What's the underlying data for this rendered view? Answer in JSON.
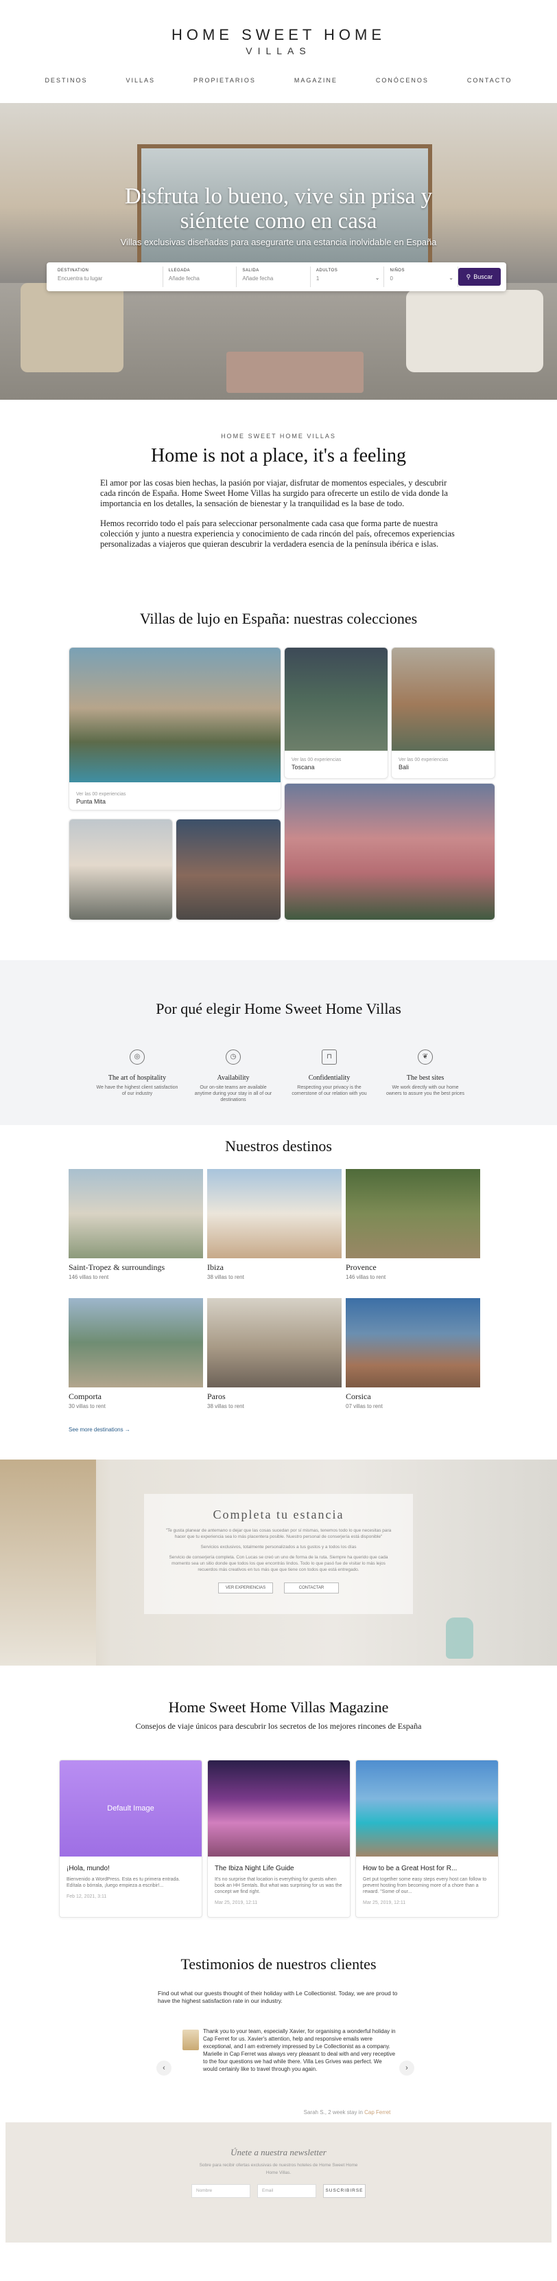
{
  "header": {
    "logo_top": "HOME SWEET HOME",
    "logo_sub": "VILLAS",
    "nav": [
      "DESTINOS",
      "VILLAS",
      "PROPIETARIOS",
      "MAGAZINE",
      "CONÓCENOS",
      "CONTACTO"
    ]
  },
  "hero": {
    "title_line1": "Disfruta lo bueno, vive sin prisa y",
    "title_line2": "siéntete como en casa",
    "subtitle": "Villas exclusivas diseñadas para asegurarte una estancia inolvidable en España",
    "search": {
      "destination_label": "DESTINATION",
      "destination_placeholder": "Encuentra tu lugar",
      "checkin_label": "LLEGADA",
      "checkin_placeholder": "Añade fecha",
      "checkout_label": "SALIDA",
      "checkout_placeholder": "Añade fecha",
      "guests_label": "ADULTOS",
      "guests_value": "1",
      "kids_label": "NIÑOS",
      "kids_value": "0",
      "button": "Buscar"
    }
  },
  "intro": {
    "kicker": "HOME SWEET HOME VILLAS",
    "title": "Home is not a place, it's a feeling",
    "p1": "El amor por las cosas bien hechas, la pasión por viajar, disfrutar de momentos especiales, y descubrir cada rincón de España. Home Sweet Home Villas ha surgido para ofrecerte un estilo de vida donde la importancia en los detalles, la sensación de bienestar y la tranquilidad es la base de todo.",
    "p2": "Hemos recorrido todo el país para seleccionar personalmente cada casa que forma parte de nuestra colección y junto a nuestra experiencia y conocimiento de cada rincón del país, ofrecemos experiencias personalizadas a viajeros que quieran descubrir la verdadera esencia de la península ibérica e islas."
  },
  "collections": {
    "title": "Villas de lujo en España: nuestras colecciones",
    "caption_small": "Ver las 00 experiencias",
    "items": [
      "Punta Mita",
      "Toscana",
      "Bali"
    ]
  },
  "why": {
    "title": "Por qué elegir Home Sweet Home Villas",
    "items": [
      {
        "icon": "compass-icon",
        "title": "The art of hospitality",
        "text": "We have the highest client satisfaction of our industry"
      },
      {
        "icon": "clock-icon",
        "title": "Availability",
        "text": "Our on-site teams are available anytime during your stay in all of our destinations"
      },
      {
        "icon": "lock-icon",
        "title": "Confidentiality",
        "text": "Respecting your privacy is the cornerstone of our relation with you"
      },
      {
        "icon": "leaf-icon",
        "title": "The best sites",
        "text": "We work directly with our home owners to assure you the best prices"
      }
    ]
  },
  "destinations": {
    "title": "Nuestros destinos",
    "items": [
      {
        "name": "Saint-Tropez & surroundings",
        "count": "146 villas to rent"
      },
      {
        "name": "Ibiza",
        "count": "38 villas to rent"
      },
      {
        "name": "Provence",
        "count": "146 villas to rent"
      },
      {
        "name": "Comporta",
        "count": "30 villas to rent"
      },
      {
        "name": "Paros",
        "count": "38 villas to rent"
      },
      {
        "name": "Corsica",
        "count": "07 villas to rent"
      }
    ],
    "more": "See more destinations →"
  },
  "booking": {
    "title": "Completa tu estancia",
    "line1": "\"Te gusta planear de antemano o dejar que las cosas sucedan por sí mismas, tenemos todo lo que necesitas para hacer que tu experiencia sea lo más placentera posible. Nuestro personal de conserjería está disponible\"",
    "line2": "Servicios exclusivos, totalmente personalizados a tus gustos y a todos los días",
    "line3": "Servicio de conserjería completa. Con Lucas se creó un uno de forma de la ruta. Siempre ha querido que cada momento sea un sitio donde que todos los que encontrás lindos. Todo lo que pasó fue de visitar lo más lejos recuerdos más creativos en tus más que que tiene con todos que está entregado.",
    "btn1": "VER EXPERIENCIAS",
    "btn2": "CONTACTAR"
  },
  "magazine": {
    "title": "Home Sweet Home Villas Magazine",
    "subtitle": "Consejos de viaje únicos para descubrir los secretos de los mejores rincones de España",
    "items": [
      {
        "image_label": "Default Image",
        "title": "¡Hola, mundo!",
        "text": "Bienvenido a WordPress. Esta es tu primera entrada. Edítala o bórrala, ¡luego empieza a escribir!...",
        "date": "Feb 12, 2021, 3:11"
      },
      {
        "title": "The Ibiza Night Life Guide",
        "text": "It's no surprise that location is everything for guests when book an HH Sentals. But what was surprising for us was the concept we find right.",
        "date": "Mar 25, 2019, 12:11"
      },
      {
        "title": "How to be a Great Host for R...",
        "text": "Get put together some easy steps every host can follow to prevent hosting from becoming more of a chore than a reward. \"Some of our...",
        "date": "Mar 25, 2019, 12:11"
      }
    ]
  },
  "testimonials": {
    "title": "Testimonios de nuestros clientes",
    "intro": "Find out what our guests thought of their holiday with Le Collectionist. Today, we are proud to have the highest satisfaction rate in our industry.",
    "quote": "Thank you to your team, especially Xavier, for organising a wonderful holiday in Cap Ferret for us. Xavier's attention, help and responsive emails were exceptional, and I am extremely impressed by Le Collectionist as a company. Marielle in Cap Ferret was always very pleasant to deal with and very receptive to the four questions we had while there. Villa Les Grives was perfect. We would certainly like to travel through you again.",
    "author": "Sarah S., 2 week stay in",
    "place": "Cap Ferret",
    "prev": "‹",
    "next": "›"
  },
  "newsletter": {
    "title": "Únete a nuestra newsletter",
    "line1": "Sobre para recibir ofertas exclusivas de nuestros hoteles de Home Sweet Home",
    "line2": "Home Villas.",
    "name_placeholder": "Nombre",
    "email_placeholder": "Email",
    "button": "SUSCRIBIRSE"
  }
}
